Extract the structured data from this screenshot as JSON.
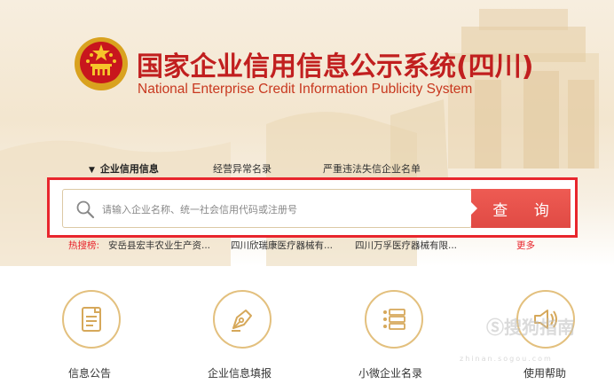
{
  "header": {
    "title_cn": "国家企业信用信息公示系统(四川)",
    "title_en": "National Enterprise Credit Information Publicity System"
  },
  "tabs": [
    {
      "label": "企业信用信息",
      "active": true
    },
    {
      "label": "经营异常名录",
      "active": false
    },
    {
      "label": "严重违法失信企业名单",
      "active": false
    }
  ],
  "search": {
    "placeholder": "请输入企业名称、统一社会信用代码或注册号",
    "button_label": "查 询"
  },
  "hot_search": {
    "label": "热搜榜:",
    "items": [
      "安岳县宏丰农业生产资...",
      "四川欣瑞康医疗器械有...",
      "四川万孚医疗器械有限..."
    ],
    "more_label": "更多"
  },
  "features": [
    {
      "label": "信息公告",
      "icon": "document-icon"
    },
    {
      "label": "企业信息填报",
      "icon": "pen-nib-icon"
    },
    {
      "label": "小微企业名录",
      "icon": "list-icon"
    },
    {
      "label": "使用帮助",
      "icon": "speaker-help-icon"
    }
  ],
  "watermark": {
    "text": "Ⓢ搜狗指南",
    "sub": "zhinan.sogou.com"
  },
  "colors": {
    "brand_red": "#c11f1f",
    "accent_red": "#e8262d",
    "button_red": "#e04a44",
    "gold": "#e3c07e"
  }
}
